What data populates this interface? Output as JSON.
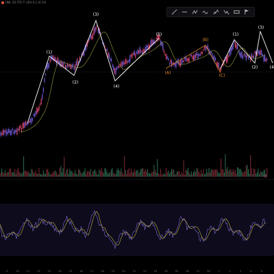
{
  "header": {
    "symbol_text": "UNI, 1D (TF) T: (45) 0.1 (0.15)"
  },
  "toolbar": {
    "tools": [
      "trend-line-icon",
      "horizontal-line-icon",
      "zigzag-tool-icon",
      "wave-tool-icon",
      "elliott-wave-icon",
      "elliott-correction-icon",
      "measure-icon",
      "flag-icon"
    ]
  },
  "colors": {
    "background": "#000000",
    "candle_up": "#d9456b",
    "candle_down": "#6f5bd8",
    "wave_primary": "#ffffff",
    "wave_orange": "#e08a2e",
    "ma_line": "#c8b44a",
    "oscillator_main": "#8a76e0",
    "oscillator_signal": "#c8b44a",
    "volume_up": "#2f7a5a",
    "volume_down": "#8a2f3a"
  },
  "wave_labels": {
    "left": [
      "(1)",
      "(2)",
      "(3)",
      "(4)",
      "(5)"
    ],
    "middle": [
      "(A)",
      "(B)",
      "(C)"
    ],
    "right": [
      "(1)",
      "(2)",
      "(3)",
      "(4)"
    ]
  },
  "x_axis": {
    "labels": [
      "9",
      "10",
      "11",
      "12",
      "13",
      "14",
      "15",
      "16",
      "17",
      "18",
      "19",
      "20",
      "21",
      "22",
      "23",
      "24",
      "25",
      "26",
      "27",
      "28",
      "1",
      "2",
      "3",
      "4",
      "5"
    ]
  }
}
